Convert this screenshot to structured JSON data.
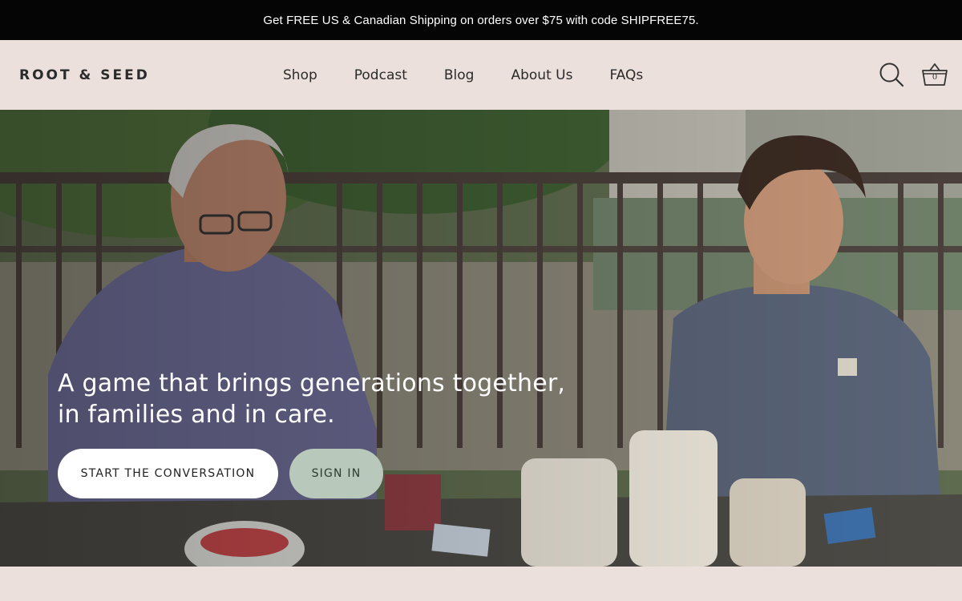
{
  "announcement": {
    "text": "Get FREE US & Canadian Shipping on orders over $75 with code SHIPFREE75."
  },
  "header": {
    "logo_text": "ROOT & SEED",
    "nav": [
      {
        "label": "Shop"
      },
      {
        "label": "Podcast"
      },
      {
        "label": "Blog"
      },
      {
        "label": "About Us"
      },
      {
        "label": "FAQs"
      }
    ],
    "icons": {
      "search": "search-icon",
      "cart": "basket-icon"
    },
    "cart_count": "0"
  },
  "hero": {
    "headline_line1": "A game that brings generations together,",
    "headline_line2": "in families and in care.",
    "primary_button": "START THE CONVERSATION",
    "secondary_button": "SIGN IN"
  },
  "colors": {
    "announcement_bg": "#050505",
    "header_bg": "#ece0dc",
    "primary_button_bg": "#ffffff",
    "secondary_button_bg": "#b8c9bb"
  }
}
